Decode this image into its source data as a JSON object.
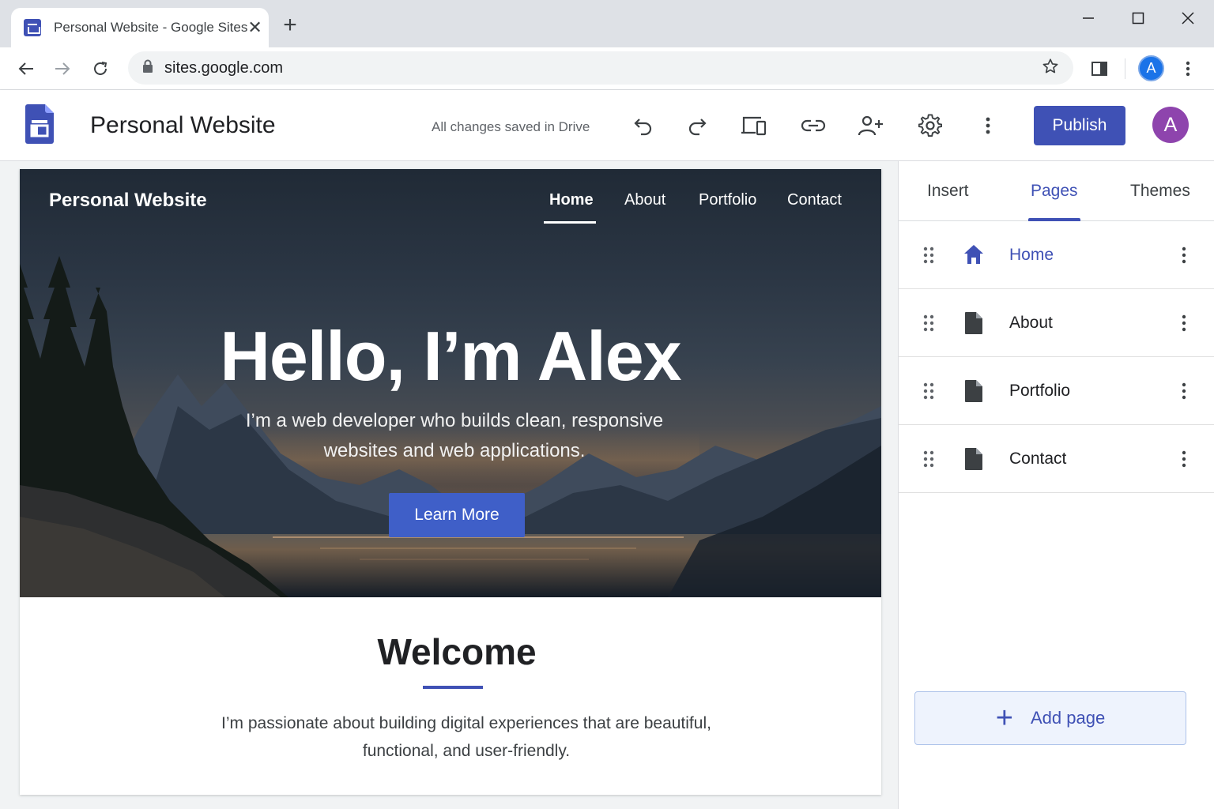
{
  "browser": {
    "tab_title": "Personal Website - Google Sites",
    "url": "sites.google.com",
    "profile_initial": "A"
  },
  "toolbar": {
    "document_title": "Personal Website",
    "save_status": "All changes saved in Drive",
    "publish_label": "Publish",
    "user_initial": "A"
  },
  "site": {
    "site_name": "Personal Website",
    "nav": [
      "Home",
      "About",
      "Portfolio",
      "Contact"
    ],
    "active_nav": "Home",
    "hero_heading": "Hello, I’m Alex",
    "hero_subtitle": "I’m a web developer who builds clean, responsive websites and web applications.",
    "cta_label": "Learn More",
    "welcome_title": "Welcome",
    "welcome_text": "I’m passionate about building digital experiences that are beautiful, functional, and user-friendly."
  },
  "panel": {
    "tabs": [
      "Insert",
      "Pages",
      "Themes"
    ],
    "active_tab": "Pages",
    "pages": [
      {
        "label": "Home",
        "icon": "home-icon"
      },
      {
        "label": "About",
        "icon": "page-icon"
      },
      {
        "label": "Portfolio",
        "icon": "page-icon"
      },
      {
        "label": "Contact",
        "icon": "page-icon"
      }
    ],
    "add_page_label": "Add page"
  },
  "colors": {
    "accent": "#3f51b5",
    "avatar_purple": "#8e44ad",
    "chrome_avatar": "#1a73e8"
  }
}
